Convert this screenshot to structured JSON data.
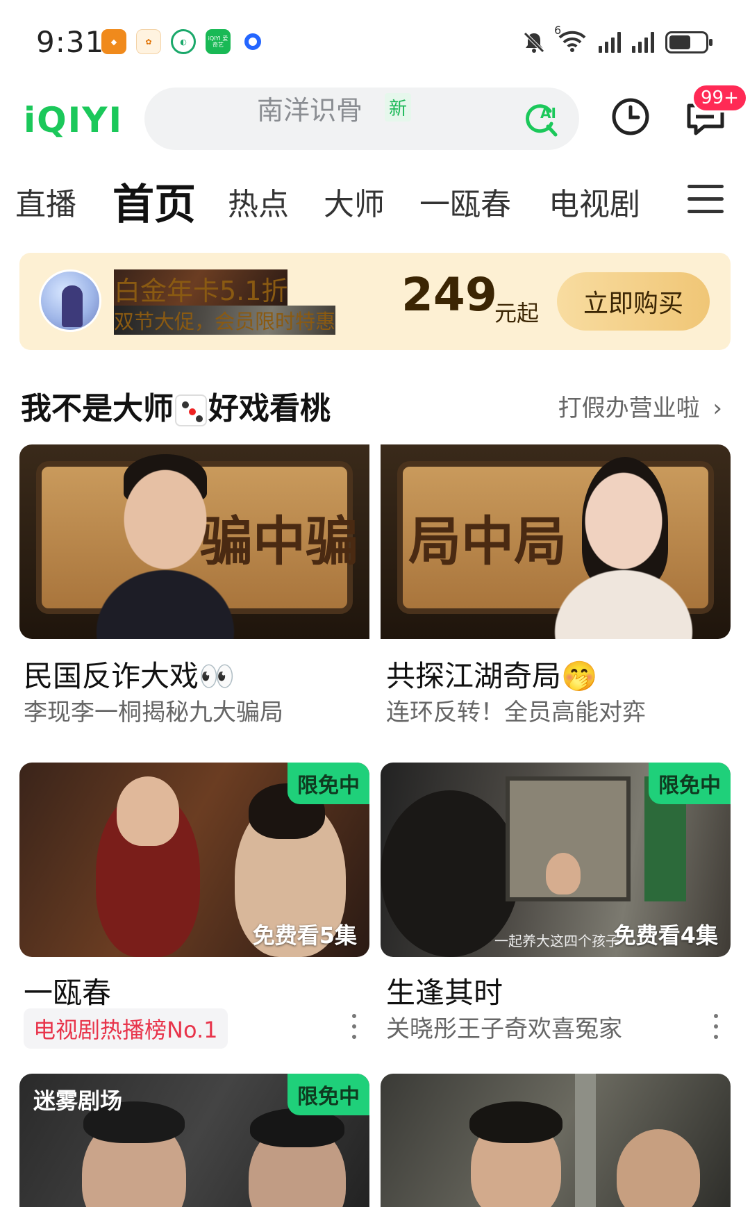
{
  "status": {
    "time": "9:31",
    "apps": [
      {
        "icon": "orange-app-icon",
        "label": ""
      },
      {
        "icon": "pine-app-icon",
        "label": ""
      },
      {
        "icon": "green-circle-app-icon",
        "label": ""
      },
      {
        "icon": "iqiyi-app-icon",
        "label": "iQIYI 爱奇艺"
      },
      {
        "icon": "blue-ring-app-icon",
        "label": ""
      }
    ],
    "signal_badge": "6"
  },
  "header": {
    "logo": "iQIYI",
    "search_placeholder": "南洋识骨",
    "search_tag": "新",
    "ai_label": "AI",
    "badge": "99+"
  },
  "nav": {
    "tabs": [
      "直播",
      "首页",
      "热点",
      "大师",
      "一瓯春",
      "电视剧"
    ],
    "active": "首页"
  },
  "promo": {
    "title": "白金年卡5.1折",
    "subtitle": "双节大促，会员限时特惠",
    "price": "249",
    "price_unit": "元起",
    "button": "立即购买"
  },
  "section": {
    "title_a": "我不是大师",
    "title_b": "好戏看桃",
    "more": "打假办营业啦"
  },
  "featured": [
    {
      "banner_text": "骗中骗",
      "title": "民国反诈大戏👀",
      "subtitle": "李现李一桐揭秘九大骗局"
    },
    {
      "banner_text": "局中局",
      "title": "共探江湖奇局🤭",
      "subtitle": "连环反转！全员高能对弈"
    }
  ],
  "cards": [
    {
      "title": "一瓯春",
      "badge": "限免中",
      "episodes": "免费看5集",
      "rank": "电视剧热播榜No.1",
      "caption": ""
    },
    {
      "title": "生逢其时",
      "badge": "限免中",
      "episodes": "免费看4集",
      "subtitle": "关晓彤王子奇欢喜冤家",
      "caption": "一起养大这四个孩子"
    },
    {
      "badge": "限免中",
      "brand": "迷雾剧场"
    },
    {}
  ]
}
